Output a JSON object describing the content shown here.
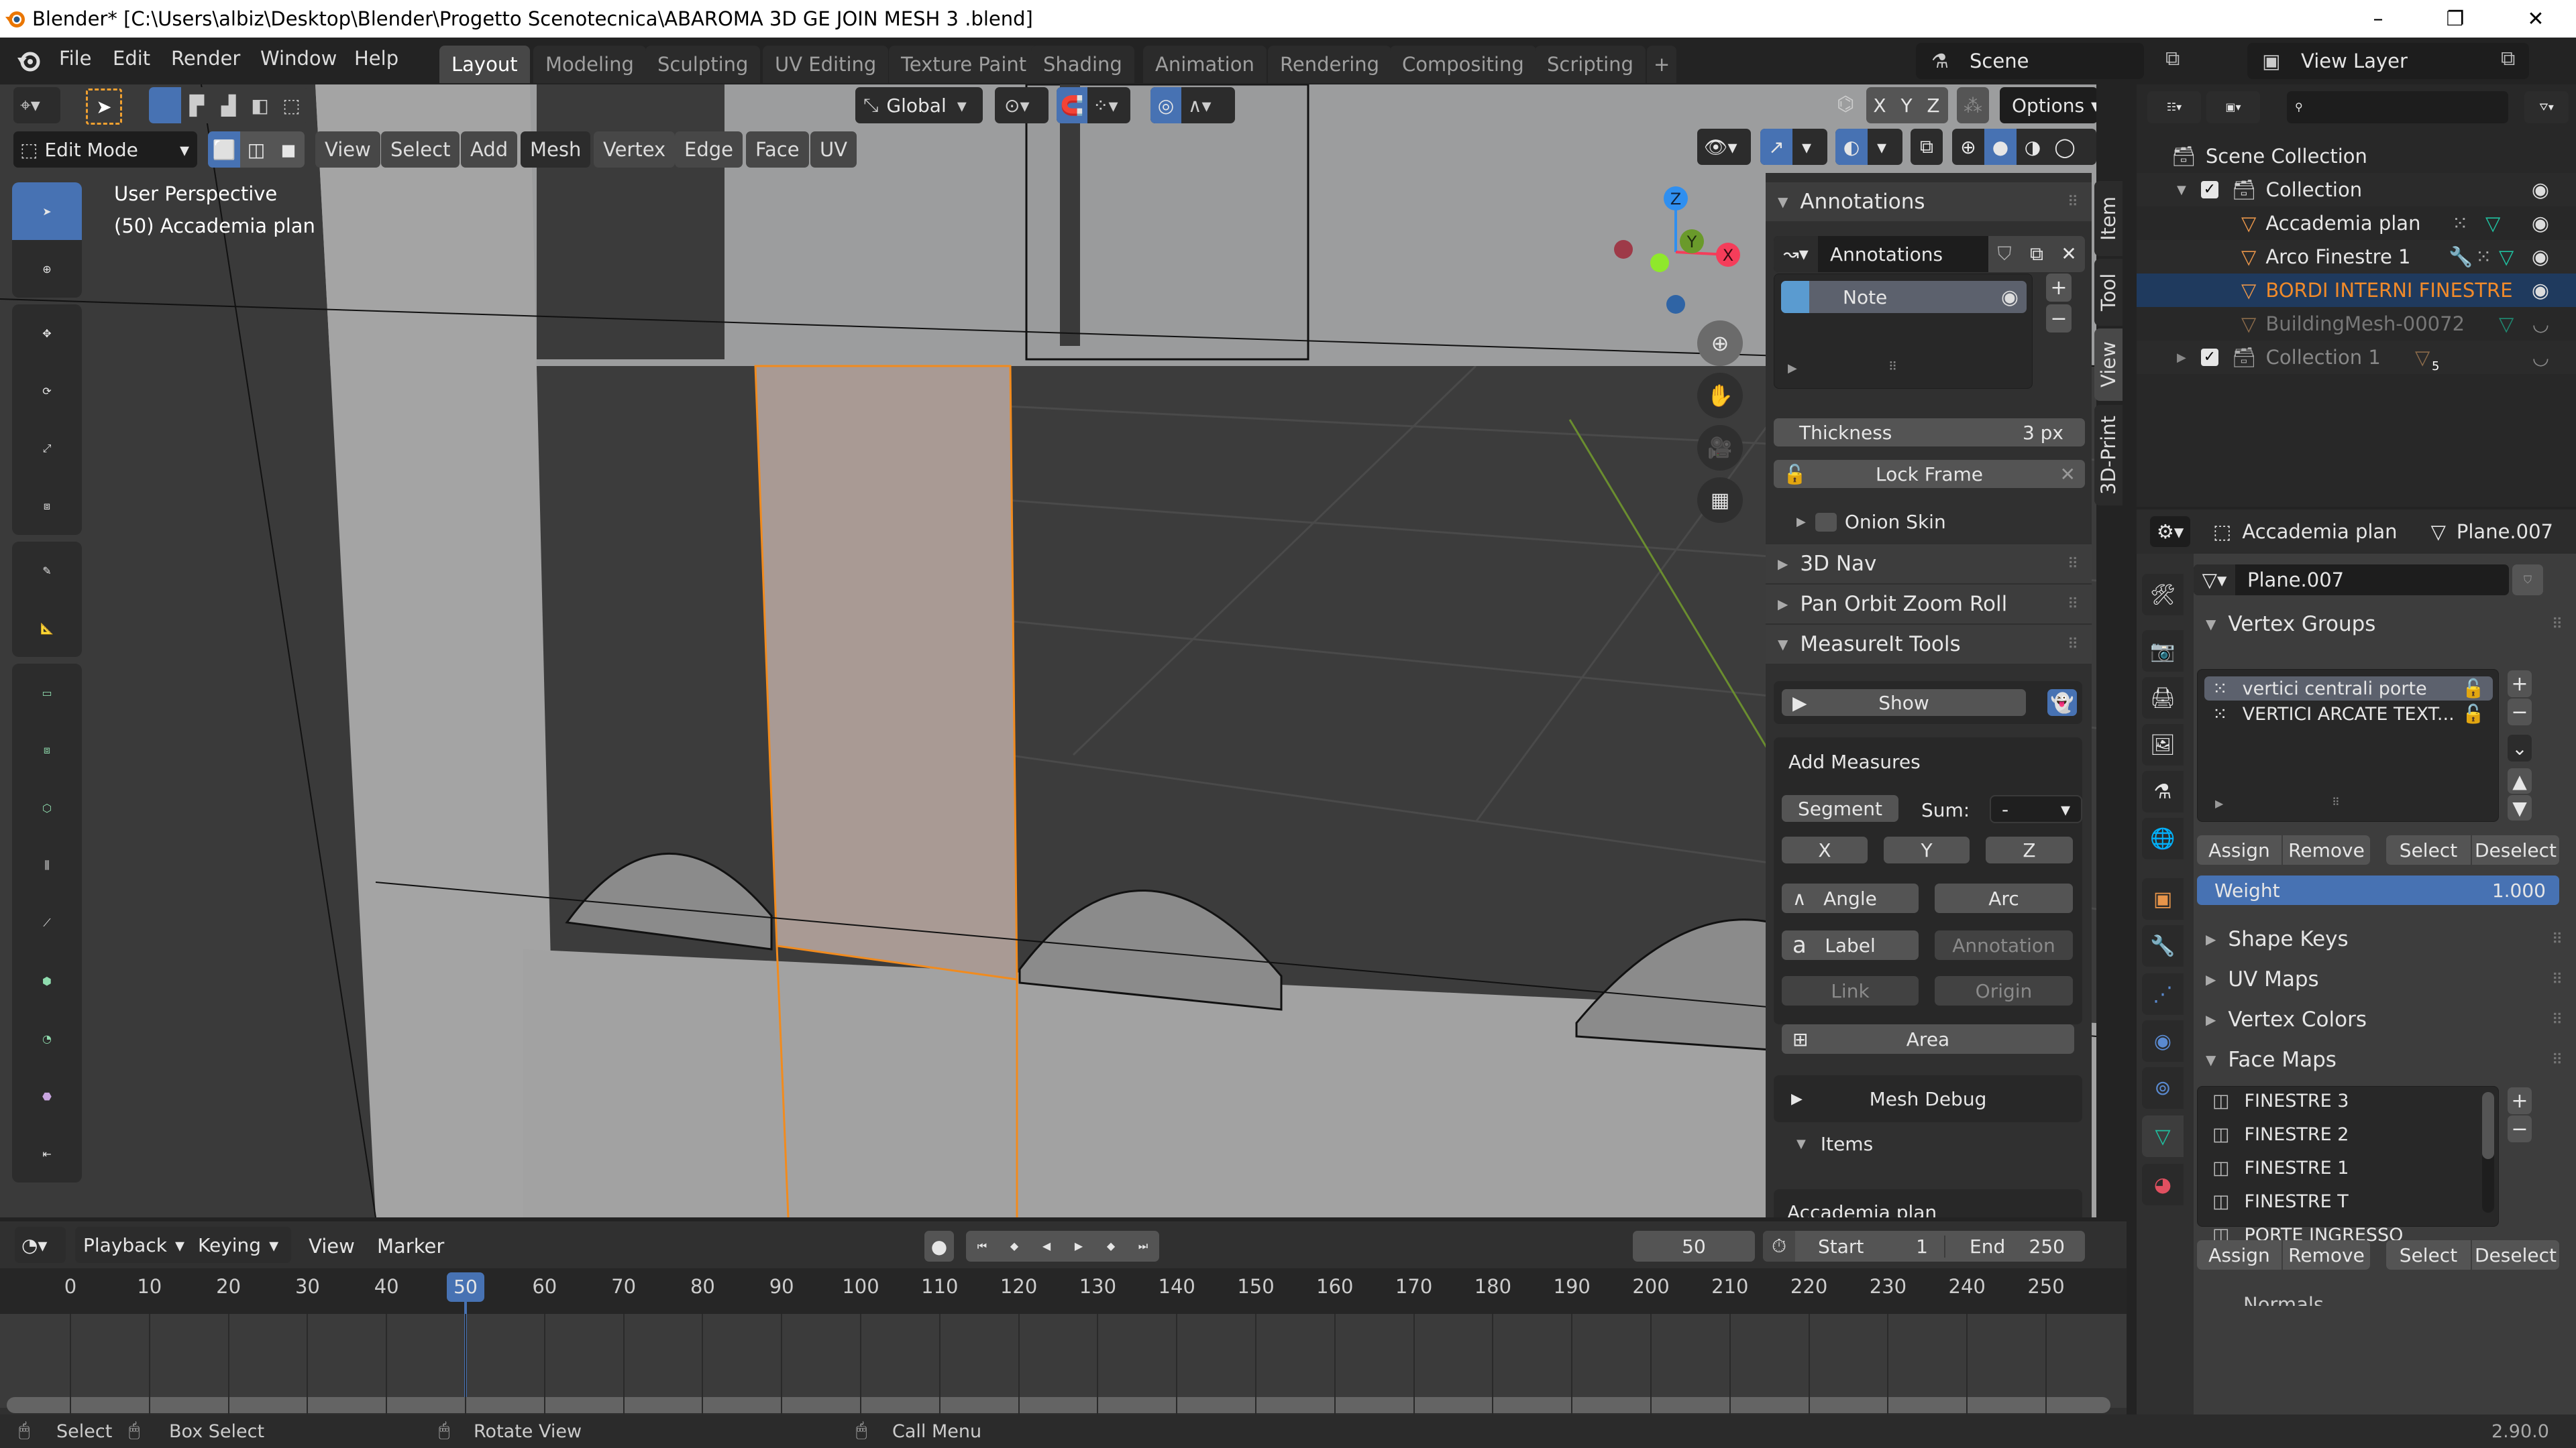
{
  "window": {
    "title": "Blender* [C:\\Users\\albiz\\Desktop\\Blender\\Progetto Scenotecnica\\ABAROMA 3D GE JOIN MESH 3 .blend]",
    "controls": {
      "minimize": "–",
      "maximize": "❐",
      "close": "✕"
    }
  },
  "menu": [
    "File",
    "Edit",
    "Render",
    "Window",
    "Help"
  ],
  "workspaces": [
    {
      "label": "Layout",
      "active": true
    },
    {
      "label": "Modeling"
    },
    {
      "label": "Sculpting"
    },
    {
      "label": "UV Editing"
    },
    {
      "label": "Texture Paint"
    },
    {
      "label": "Shading"
    },
    {
      "label": "Animation"
    },
    {
      "label": "Rendering"
    },
    {
      "label": "Compositing"
    },
    {
      "label": "Scripting"
    },
    {
      "label": "+"
    }
  ],
  "scene": {
    "name": "Scene",
    "view_layer": "View Layer"
  },
  "tool_header": {
    "orientation": "Global",
    "mirror_axes": [
      "X",
      "Y",
      "Z"
    ],
    "options_label": "Options"
  },
  "viewport_header": {
    "mode": "Edit Mode",
    "menus": [
      "View",
      "Select",
      "Add",
      "Mesh",
      "Vertex",
      "Edge",
      "Face",
      "UV"
    ]
  },
  "viewport": {
    "perspective_label": "User Perspective",
    "object_label": "(50) Accademia plan",
    "gizmo_axes": {
      "x": "X",
      "y": "Y",
      "z": "Z"
    },
    "axis_colors": {
      "x": "#f53d5a",
      "y": "#6a9a2b",
      "z": "#2f8ff0"
    },
    "selected_face_color": "#a99a94",
    "selection_edge_color": "#f18b1e"
  },
  "left_tools": [
    "select-box",
    "cursor",
    "move",
    "rotate",
    "scale",
    "transform",
    "annotate",
    "measure",
    "extrude-region",
    "inset-faces",
    "bevel",
    "loop-cut",
    "knife",
    "poly-build",
    "spin",
    "smooth",
    "edge-slide",
    "shrink-fatten"
  ],
  "npanel": {
    "tabs": [
      {
        "label": "Item"
      },
      {
        "label": "Tool"
      },
      {
        "label": "View",
        "active": true
      },
      {
        "label": "3D-Print"
      }
    ],
    "annotations": {
      "title": "Annotations",
      "datablock": "Annotations",
      "layers": [
        {
          "name": "Note",
          "color": "#5a9bd0"
        }
      ],
      "thickness_label": "Thickness",
      "thickness_value": "3 px",
      "lock_frame": "Lock Frame",
      "onion_skin": "Onion Skin"
    },
    "panels_collapsed": [
      "3D Nav",
      "Pan Orbit Zoom Roll"
    ],
    "measureit": {
      "title": "MeasureIt Tools",
      "show_label": "Show",
      "add_measures_title": "Add Measures",
      "segment": "Segment",
      "sum_label": "Sum:",
      "sum_value": "-",
      "axis_buttons": [
        "X",
        "Y",
        "Z"
      ],
      "angle": "Angle",
      "arc": "Arc",
      "label": "Label",
      "annotation": "Annotation",
      "link": "Link",
      "origin": "Origin",
      "area": "Area",
      "mesh_debug": "Mesh Debug",
      "items_title": "Items",
      "items_first": "Accademia plan"
    }
  },
  "outliner": {
    "search_placeholder": "",
    "scene_collection": "Scene Collection",
    "rows": [
      {
        "name": "Collection",
        "type": "collection",
        "checked": true
      },
      {
        "name": "Accademia plan",
        "type": "mesh"
      },
      {
        "name": "Arco Finestre 1",
        "type": "mesh"
      },
      {
        "name": "BORDI INTERNI FINESTRE",
        "type": "mesh",
        "selected": true
      },
      {
        "name": "BuildingMesh-00072",
        "type": "mesh",
        "hidden": true
      },
      {
        "name": "Collection 1",
        "type": "collection",
        "checked": true,
        "child_count": "5"
      }
    ]
  },
  "properties": {
    "object_name": "Accademia plan",
    "mesh_name": "Plane.007",
    "mesh_field": "Plane.007",
    "vertex_groups": {
      "title": "Vertex Groups",
      "items": [
        "vertici centrali porte",
        "VERTICI ARCATE TEXT..."
      ],
      "assign": "Assign",
      "remove": "Remove",
      "select": "Select",
      "deselect": "Deselect",
      "weight_label": "Weight",
      "weight_value": "1.000"
    },
    "collapsed_panels": [
      "Shape Keys",
      "UV Maps",
      "Vertex Colors"
    ],
    "face_maps": {
      "title": "Face Maps",
      "items": [
        "FINESTRE 3",
        "FINESTRE 2",
        "FINESTRE 1",
        "FINESTRE T",
        "PORTE INGRESSO"
      ],
      "assign": "Assign",
      "remove": "Remove",
      "select": "Select",
      "deselect": "Deselect"
    },
    "next_panel": "Normals"
  },
  "timeline": {
    "menus": [
      "Playback",
      "Keying",
      "View",
      "Marker"
    ],
    "current_frame": "50",
    "start_label": "Start",
    "start": "1",
    "end_label": "End",
    "end": "250",
    "ticks": [
      "0",
      "10",
      "20",
      "30",
      "40",
      "50",
      "60",
      "70",
      "80",
      "90",
      "100",
      "110",
      "120",
      "130",
      "140",
      "150",
      "160",
      "170",
      "180",
      "190",
      "200",
      "210",
      "220",
      "230",
      "240",
      "250"
    ]
  },
  "statusbar": {
    "select": "Select",
    "box_select": "Box Select",
    "rotate_view": "Rotate View",
    "call_menu": "Call Menu",
    "version": "2.90.0"
  }
}
